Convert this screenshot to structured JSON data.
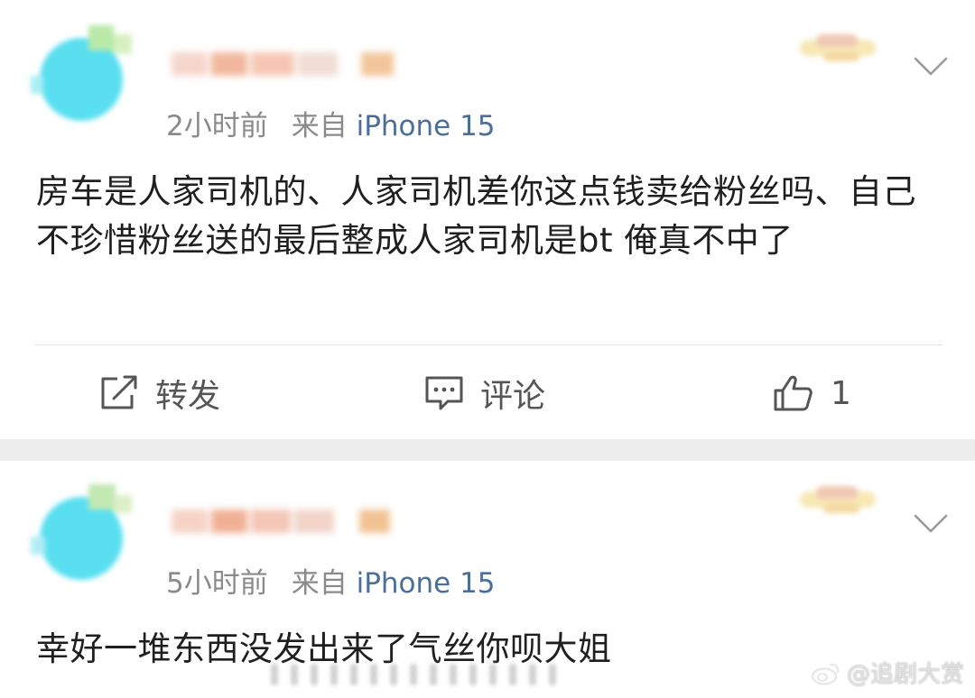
{
  "posts": [
    {
      "time": "2小时前",
      "source_prefix": "来自",
      "device": "iPhone 15",
      "content": "房车是人家司机的、人家司机差你这点钱卖给粉丝吗、自己不珍惜粉丝送的最后整成人家司机是bt 俺真不中了",
      "actions": {
        "repost": "转发",
        "comment": "评论",
        "like_count": "1"
      }
    },
    {
      "time": "5小时前",
      "source_prefix": "来自",
      "device": "iPhone 15",
      "content": "幸好一堆东西没发出来了气丝你呗大姐"
    }
  ],
  "watermark": "@追剧大赏",
  "icons": [
    "chevron-down-icon",
    "repost-icon",
    "comment-icon",
    "like-icon",
    "weibo-logo-icon"
  ],
  "colors": {
    "meta_gray": "#8a8a8a",
    "device_blue": "#4a6f9b",
    "separator": "#ededed",
    "avatar_cyan": "#59dff0"
  }
}
